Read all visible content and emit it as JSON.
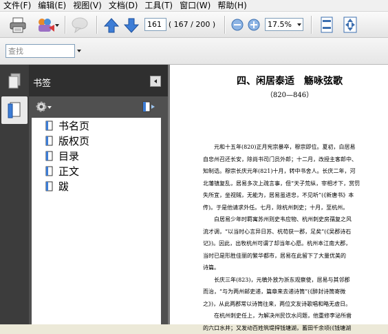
{
  "menu": [
    "文件(F)",
    "编辑(E)",
    "视图(V)",
    "文档(D)",
    "工具(T)",
    "窗口(W)",
    "帮助(H)"
  ],
  "toolbar": {
    "page_current": "161",
    "page_total": "( 167 / 200 )",
    "zoom": "17.5%",
    "search_placeholder": "查找"
  },
  "panel": {
    "title": "书签",
    "bookmarks": [
      "书名页",
      "版权页",
      "目录",
      "正文",
      "跋"
    ]
  },
  "page": {
    "title": "四、闲居泰适　觞咏弦歌",
    "subtitle": "（820—846）",
    "lines": [
      "　　元和十五年(820)正月宪宗暴卒，穆宗即位。夏初，白居易",
      "自忠州召还长安，除尚书司门员外郎；十二月，改授主客郎中、",
      "知制诰。穆宗长庆元年(821)十月，转中书舍人。长庆二年，河",
      "北藩镇复乱，居易多次上疏言事，但“天子荒纵，宰相才下，赏罚",
      "失所宜，坐视贼，无能为，居易虽进忠，不见听”(《新唐书》本",
      "传)。于是他请求外任。七月，除杭州刺史；十月，至杭州。",
      "　　白居易少年时羁寓苏州则史韦应物、杭州刺史房孺复之风",
      "流才调，“以当时心言异日苏、杭苟获一郡，足矣”(《吴郡诗石",
      "记》)。因此，出牧杭州可谓了却当年心愿。杭州本江南大郡，",
      "当时已是形胜佳丽的繁华都市，居易在此留下了大量优美的",
      "诗篇。",
      "　　长庆三年(823)，元稹外放为浙东观察使，居易与其邻郡",
      "而治，“与为两州邮吏递，篇章来去递诗筒”(《醉封诗筒寄微",
      "之》)，从此两郡常以诗筒往来，两位文友诗歌唱和略无虚日。",
      "　　在杭州刺史任上，为解决州民饮水问题，他重修李泌所凿",
      "的六口水井；又发动百姓筑堤捍钱塘湖，蓄田千余顷(《钱塘湖"
    ]
  }
}
